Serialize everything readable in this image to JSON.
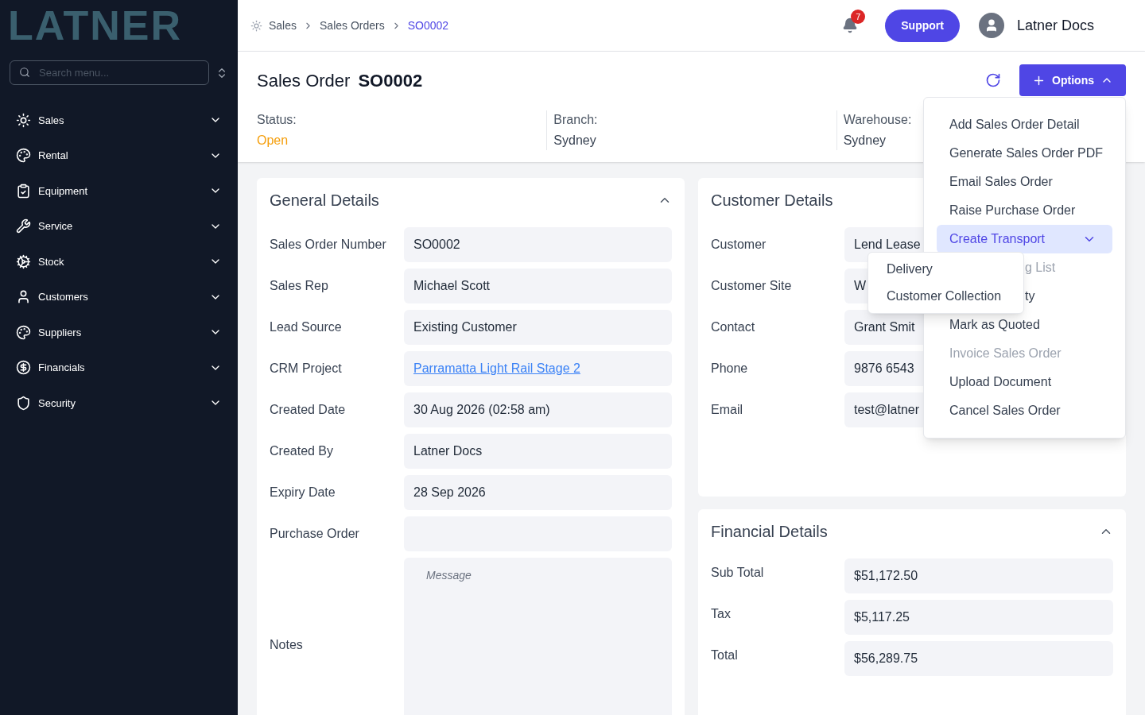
{
  "sidebar": {
    "logo": "LATNER",
    "search": {
      "placeholder": "Search menu..."
    },
    "items": [
      {
        "label": "Sales",
        "expanded": false
      },
      {
        "label": "Rental",
        "expanded": false
      },
      {
        "label": "Equipment",
        "expanded": false
      },
      {
        "label": "Service",
        "expanded": false
      },
      {
        "label": "Stock",
        "expanded": false
      },
      {
        "label": "Customers",
        "expanded": false
      },
      {
        "label": "Suppliers",
        "expanded": false
      },
      {
        "label": "Financials",
        "expanded": false
      },
      {
        "label": "Security",
        "expanded": false
      }
    ]
  },
  "breadcrumbs": [
    {
      "label": "Sales",
      "selected": false
    },
    {
      "label": "Sales Orders",
      "selected": false
    },
    {
      "label": "SO0002",
      "selected": true
    }
  ],
  "notifications": {
    "count": "7"
  },
  "support_button": "Support",
  "user": {
    "name": "Latner Docs"
  },
  "page_title": {
    "label": "Sales Order",
    "number": "SO0002"
  },
  "options_button": {
    "label": "Options",
    "expanded": true
  },
  "info": [
    {
      "label": "Status:",
      "value": "Open",
      "color": "#f59e0b"
    },
    {
      "label": "Branch:",
      "value": "Sydney",
      "color": "#374151"
    },
    {
      "label": "Warehouse:",
      "value": "Sydney",
      "color": "#374151"
    }
  ],
  "general_details": {
    "title": "General Details",
    "expanded": true,
    "rows": [
      {
        "label": "Sales Order Number",
        "kind": "text",
        "value": "SO0002"
      },
      {
        "label": "Sales Rep",
        "kind": "text",
        "value": "Michael Scott"
      },
      {
        "label": "Lead Source",
        "kind": "text",
        "value": "Existing Customer"
      },
      {
        "label": "CRM Project",
        "kind": "link",
        "value": "Parramatta Light Rail Stage 2"
      },
      {
        "label": "Created Date",
        "kind": "text",
        "value": "30 Aug 2026 (02:58 am)"
      },
      {
        "label": "Created By",
        "kind": "text",
        "value": "Latner Docs"
      },
      {
        "label": "Expiry Date",
        "kind": "text",
        "value": "28 Sep 2026"
      },
      {
        "label": "Purchase Order",
        "kind": "empty"
      },
      {
        "label": "Notes",
        "kind": "textarea",
        "placeholder": "Message"
      }
    ]
  },
  "customer_details": {
    "title": "Customer Details",
    "rows": [
      {
        "label": "Customer",
        "value": "Lend Lease"
      },
      {
        "label": "Customer Site",
        "value": "W"
      },
      {
        "label": "Contact",
        "value": "Grant Smit"
      },
      {
        "label": "Phone",
        "value": "9876 6543"
      },
      {
        "label": "Email",
        "value": "test@latner"
      }
    ]
  },
  "financial_details": {
    "title": "Financial Details",
    "expanded": true,
    "rows": [
      {
        "label": "Sub Total",
        "value": "$51,172.50"
      },
      {
        "label": "Tax",
        "value": "$5,117.25"
      },
      {
        "label": "Total",
        "value": "$56,289.75"
      }
    ]
  },
  "options_menu": [
    {
      "label": "Add Sales Order Detail",
      "kind": "action"
    },
    {
      "label": "Generate Sales Order PDF",
      "kind": "action"
    },
    {
      "label": "Email Sales Order",
      "kind": "action"
    },
    {
      "label": "Raise Purchase Order",
      "kind": "action"
    },
    {
      "label": "Create Transport",
      "kind": "submenu",
      "expanded": true,
      "children": [
        {
          "label": "Delivery"
        },
        {
          "label": "Customer Collection"
        }
      ]
    },
    {
      "label": "g List",
      "kind": "disabled",
      "partial": true
    },
    {
      "label": "ty",
      "kind": "action",
      "partial": true
    },
    {
      "label": "Mark as Quoted",
      "kind": "action"
    },
    {
      "label": "Invoice Sales Order",
      "kind": "disabled"
    },
    {
      "label": "Upload Document",
      "kind": "action"
    },
    {
      "label": "Cancel Sales Order",
      "kind": "action"
    }
  ]
}
